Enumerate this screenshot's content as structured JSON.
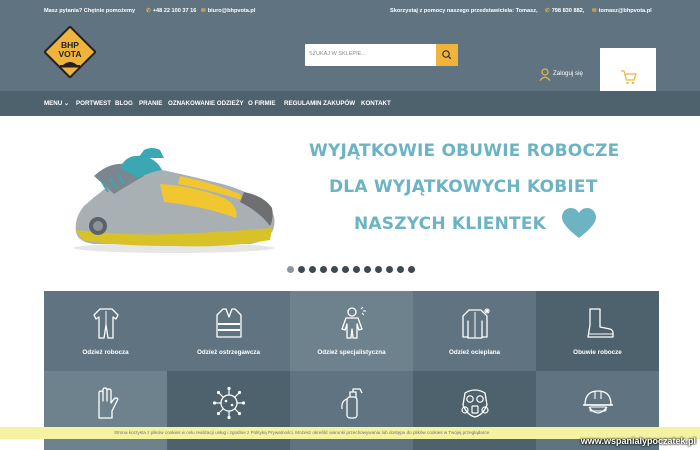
{
  "topbar": {
    "question": "Masz pytania? Chętnie pomożemy",
    "phone": "+48 22 100 37 16",
    "email": "biuro@bhpvota.pl",
    "rep_text": "Skorzystaj z pomocy naszego przedstawiciela: Tomasz,",
    "rep_phone": "798 830 882,",
    "rep_email": "tomasz@bhpvota.pl"
  },
  "logo": {
    "line1": "BHP",
    "line2": "VOTA"
  },
  "search": {
    "placeholder": "SZUKAJ W SKLEPIE..."
  },
  "account": {
    "login_label": "Zaloguj się"
  },
  "nav": {
    "items": [
      "MENU",
      "PORTWEST",
      "BLOG",
      "PRANIE",
      "OZNAKOWANIE ODZIEŻY",
      "O FIRMIE",
      "REGULAMIN ZAKUPÓW",
      "KONTAKT"
    ]
  },
  "hero": {
    "line1": "WYJĄTKOWIE OBUWIE ROBOCZE",
    "line2": "DLA WYJĄTKOWYCH KOBIET",
    "line3": "NASZYCH KLIENTEK",
    "active_slide": 1,
    "slide_count": 12
  },
  "categories": [
    {
      "label": "Odzież robocza",
      "icon": "coverall-icon"
    },
    {
      "label": "Odzież ostrzegawcza",
      "icon": "hi-vis-vest-icon"
    },
    {
      "label": "Odzież specjalistyczna",
      "icon": "hazmat-suit-icon"
    },
    {
      "label": "Odzież ocieplana",
      "icon": "winter-jacket-icon"
    },
    {
      "label": "Obuwie robocze",
      "icon": "work-boot-icon"
    },
    {
      "label": "",
      "icon": "glove-icon"
    },
    {
      "label": "",
      "icon": "virus-icon"
    },
    {
      "label": "",
      "icon": "fire-extinguisher-icon"
    },
    {
      "label": "",
      "icon": "gas-mask-icon"
    },
    {
      "label": "",
      "icon": "hard-hat-icon"
    }
  ],
  "cookie": {
    "text": "Strona korzysta z plików cookies w celu realizacji usług i zgodnie z Polityką Prywatności. Możesz określić warunki przechowywania lub dostępu do plików cookies w Twojej przeglądarce."
  },
  "watermark": "www.wspanialypoczatek.pl",
  "colors": {
    "header_bg": "#5f7480",
    "nav_bg": "#4e626d",
    "accent": "#f0b43c",
    "hero_text": "#6cb4c4",
    "tile_light": "#5f7480",
    "tile_dark": "#4e626d",
    "cookie_bg": "#f5f3a2"
  }
}
